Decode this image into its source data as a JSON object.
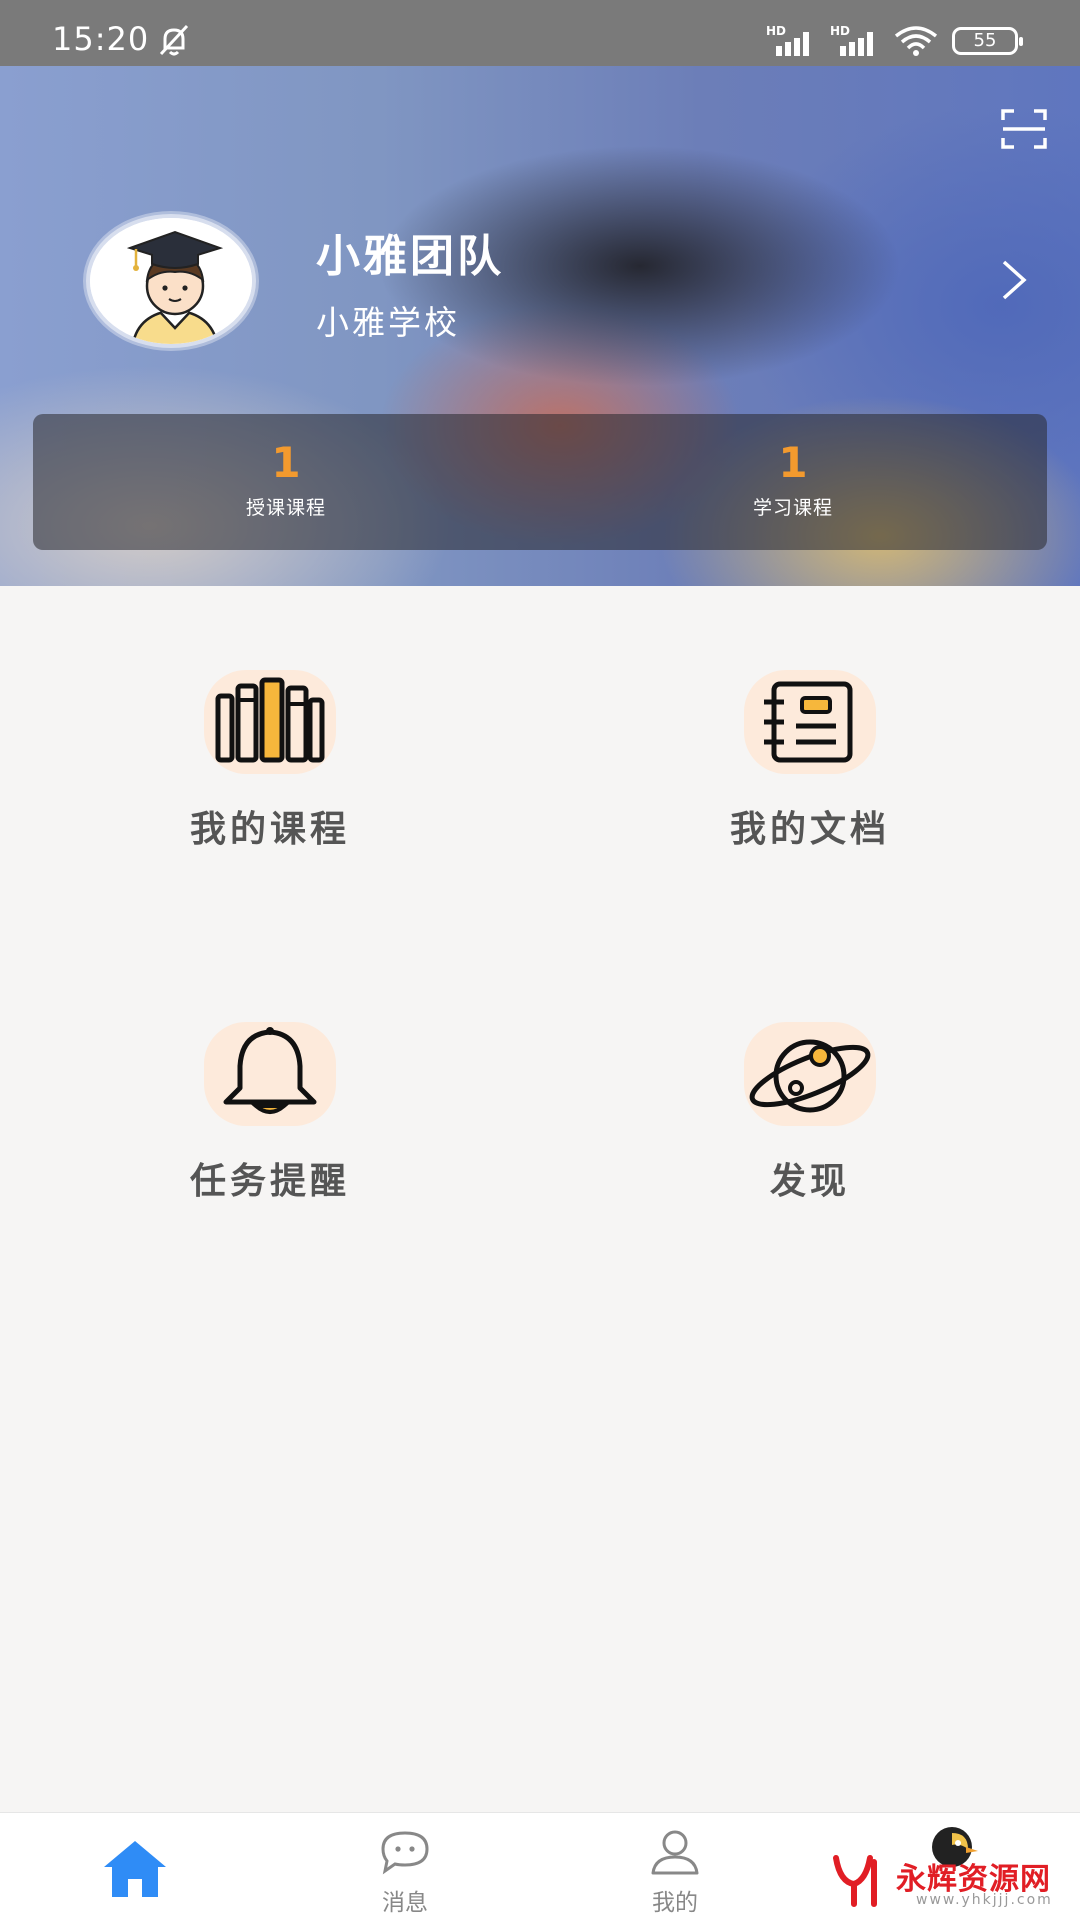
{
  "status_bar": {
    "time": "15:20",
    "signal_badge_1": "HD",
    "signal_badge_2": "HD",
    "battery": "55"
  },
  "header": {
    "name": "小雅团队",
    "school": "小雅学校",
    "stats": [
      {
        "value": "1",
        "label": "授课课程"
      },
      {
        "value": "1",
        "label": "学习课程"
      }
    ],
    "accent_color": "#f39a2e"
  },
  "grid": [
    {
      "label": "我的课程",
      "icon": "bookshelf-icon"
    },
    {
      "label": "我的文档",
      "icon": "notebook-icon"
    },
    {
      "label": "任务提醒",
      "icon": "bell-icon"
    },
    {
      "label": "发现",
      "icon": "planet-icon"
    }
  ],
  "bottom_nav": {
    "items": [
      {
        "label": "",
        "icon": "home-icon",
        "active": true
      },
      {
        "label": "消息",
        "icon": "chat-icon"
      },
      {
        "label": "我的",
        "icon": "person-icon"
      },
      {
        "label": "",
        "icon": "bird-avatar-icon"
      }
    ],
    "active_color": "#2f8cf6"
  },
  "watermark": {
    "text": "永辉资源网",
    "url": "www.yhkjjj.com"
  }
}
